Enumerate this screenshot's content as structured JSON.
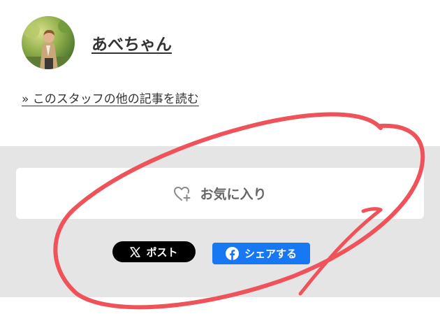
{
  "author": {
    "name": "あべちゃん",
    "more_articles_link": "» このスタッフの他の記事を読む"
  },
  "share": {
    "favorite_label": "お気に入り",
    "x_post_label": "ポスト",
    "facebook_share_label": "シェアする",
    "icons": {
      "favorite": "heart-plus-icon",
      "x": "x-logo-icon",
      "facebook": "facebook-logo-icon"
    }
  },
  "colors": {
    "band_background": "#e5e5e5",
    "x_button": "#000000",
    "facebook_button": "#1877f2",
    "annotation_stroke": "#f0525a"
  }
}
